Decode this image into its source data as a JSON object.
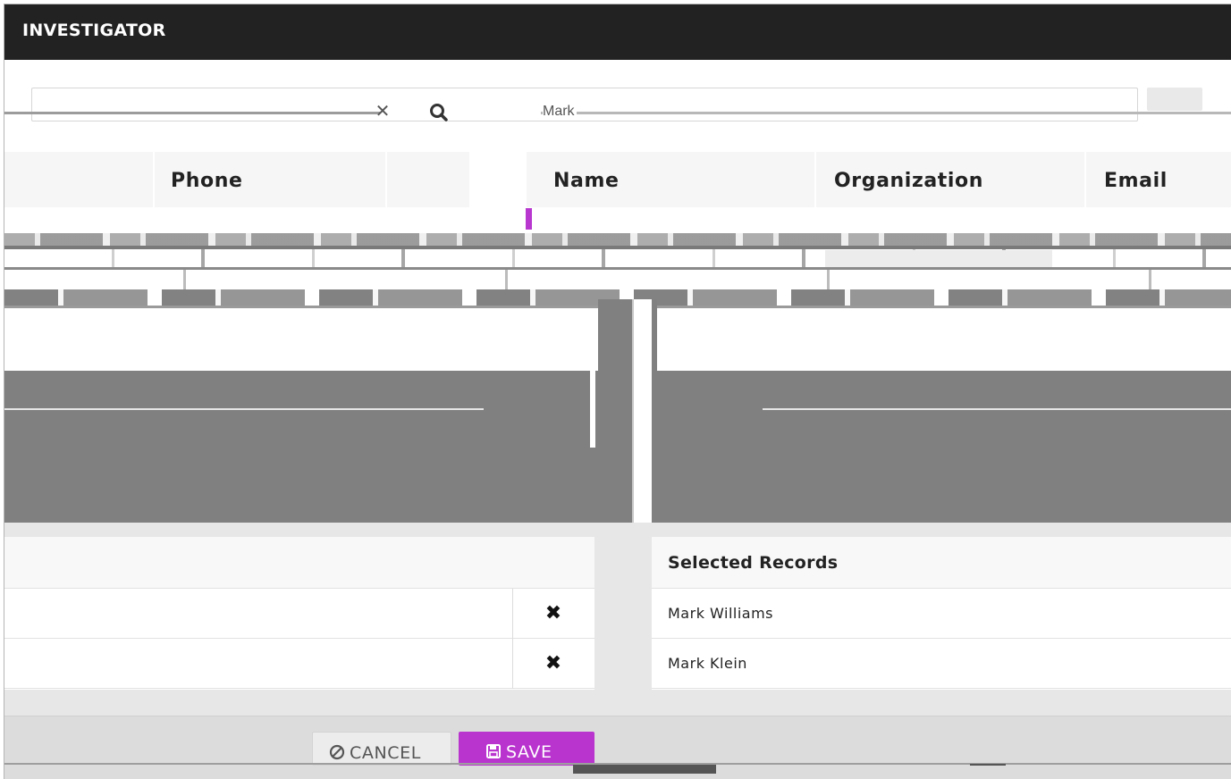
{
  "window": {
    "title": "INVESTIGATOR"
  },
  "search": {
    "query": "Mark",
    "placeholder": ""
  },
  "results": {
    "columns_left": [
      "Phone"
    ],
    "columns_right": [
      "Name",
      "Organization",
      "Email"
    ]
  },
  "selected": {
    "header": "Selected Records",
    "rows": [
      "Mark Williams",
      "Mark Klein"
    ]
  },
  "footer": {
    "cancel_label": "CANCEL",
    "save_label": "SAVE"
  },
  "colors": {
    "accent": "#b934cf",
    "titlebar": "#222222"
  },
  "icons": {
    "clear": "close-icon",
    "search": "search-icon",
    "remove": "close-icon",
    "cancel": "ban-icon",
    "save": "floppy-icon"
  }
}
